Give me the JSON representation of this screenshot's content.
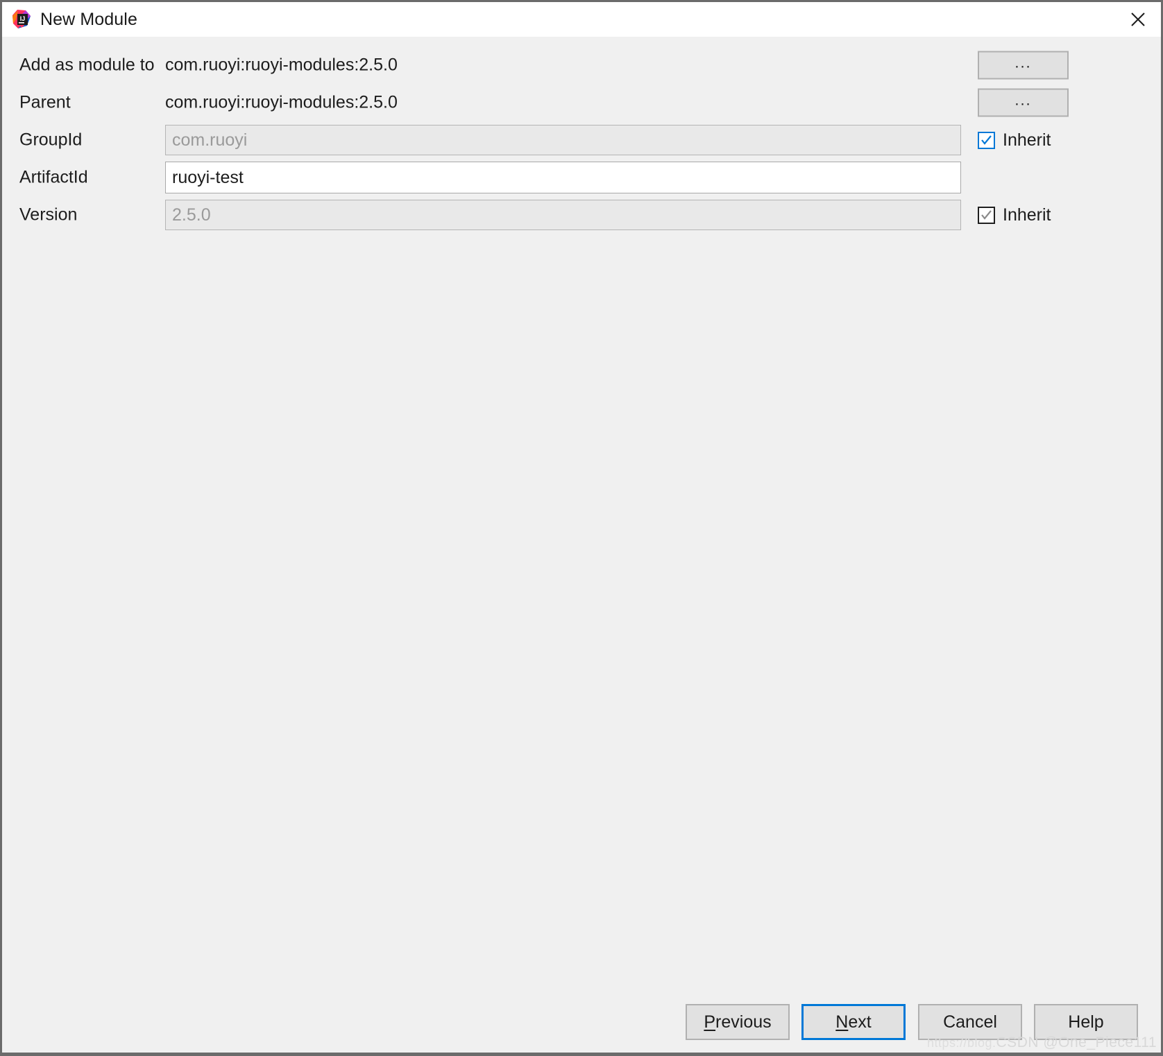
{
  "window": {
    "title": "New Module",
    "app_icon": "intellij-idea-icon",
    "close_icon": "close-icon"
  },
  "form": {
    "rows": [
      {
        "label": "Add as module to",
        "type": "static",
        "value": "com.ruoyi:ruoyi-modules:2.5.0",
        "trailing": "dots-button",
        "trailing_label": "..."
      },
      {
        "label": "Parent",
        "type": "static",
        "value": "com.ruoyi:ruoyi-modules:2.5.0",
        "trailing": "dots-button",
        "trailing_label": "..."
      },
      {
        "label": "GroupId",
        "type": "field",
        "value": "com.ruoyi",
        "enabled": false,
        "trailing": "checkbox",
        "trailing_label": "Inherit",
        "checked": true,
        "accent": "#0078d7"
      },
      {
        "label": "ArtifactId",
        "type": "field",
        "value": "ruoyi-test",
        "enabled": true,
        "trailing": "none",
        "trailing_label": ""
      },
      {
        "label": "Version",
        "type": "field",
        "value": "2.5.0",
        "enabled": false,
        "trailing": "checkbox",
        "trailing_label": "Inherit",
        "checked": true,
        "accent": "#1f1f1f"
      }
    ]
  },
  "footer": {
    "buttons": [
      {
        "label_pre": "",
        "mnemonic": "P",
        "label_post": "revious",
        "focused": false
      },
      {
        "label_pre": "",
        "mnemonic": "N",
        "label_post": "ext",
        "focused": true
      },
      {
        "label_pre": "",
        "mnemonic": "",
        "label_post": "Cancel",
        "focused": false
      },
      {
        "label_pre": "",
        "mnemonic": "",
        "label_post": "Help",
        "focused": false
      }
    ]
  },
  "watermark": {
    "url": "https://blog.",
    "text": "CSDN @One_Piece111"
  }
}
